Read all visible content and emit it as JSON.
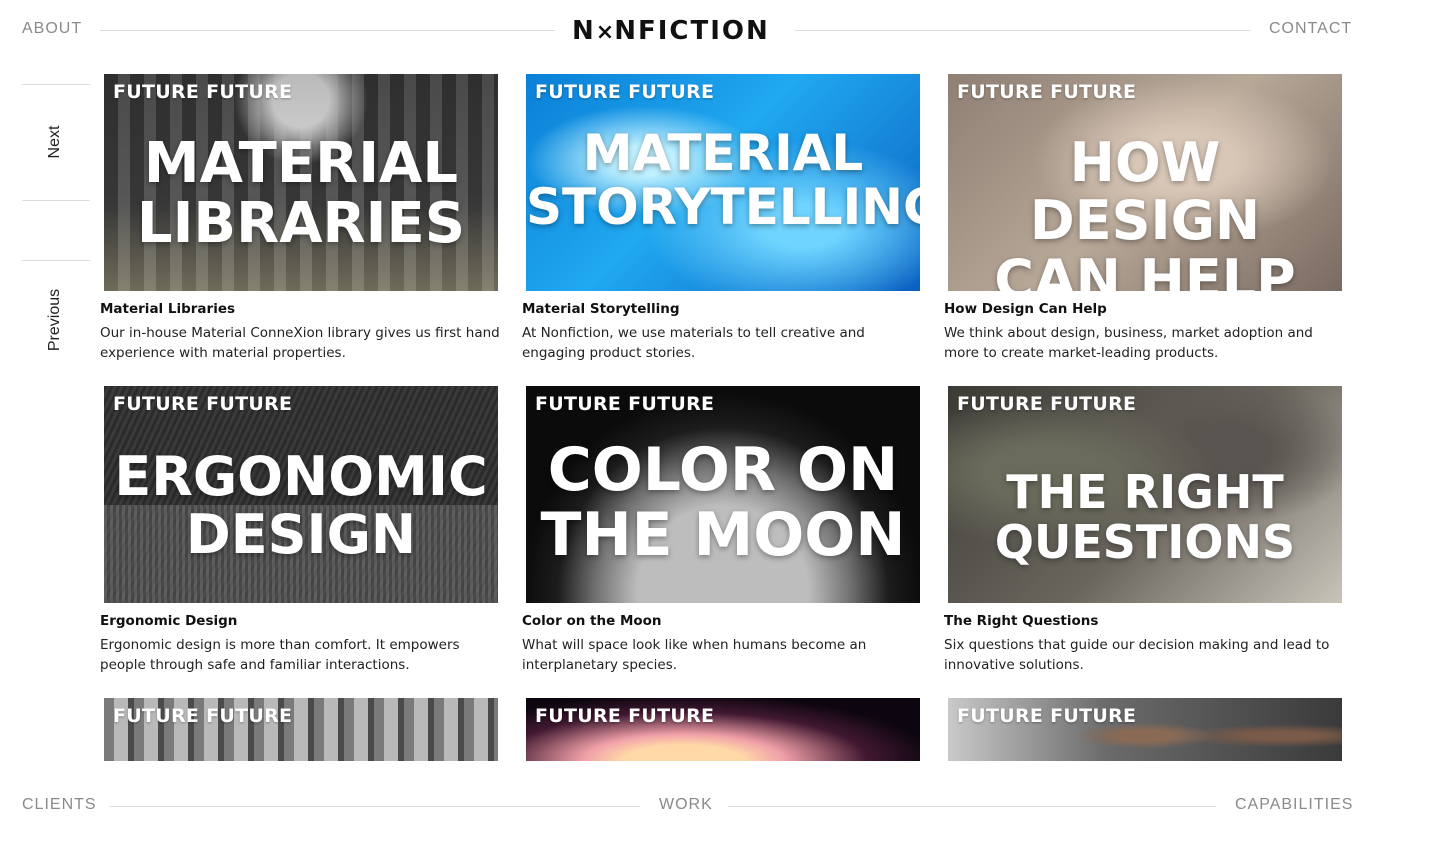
{
  "nav": {
    "about": "ABOUT",
    "contact": "CONTACT",
    "logo_left": "N",
    "logo_x": "×",
    "logo_right": "NFICTION"
  },
  "side": {
    "next": "Next",
    "previous": "Previous"
  },
  "cards": [
    {
      "tag": "FUTURE FUTURE",
      "headline": [
        "MATERIAL",
        "LIBRARIES"
      ],
      "title": "Material Libraries",
      "desc": "Our in-house Material ConneXion library gives us first hand experience with material properties."
    },
    {
      "tag": "FUTURE FUTURE",
      "headline": [
        "MATERIAL",
        "STORYTELLING"
      ],
      "title": "Material Storytelling",
      "desc": "At Nonfiction, we use materials to tell creative and engaging product stories."
    },
    {
      "tag": "FUTURE FUTURE",
      "headline": [
        "HOW DESIGN",
        "CAN HELP"
      ],
      "title": "How Design Can Help",
      "desc": "We think about design, business, market adoption and more to create market-leading products."
    },
    {
      "tag": "FUTURE FUTURE",
      "headline": [
        "ERGONOMIC",
        "DESIGN"
      ],
      "title": "Ergonomic Design",
      "desc": "Ergonomic design is more than comfort. It empowers people through safe and familiar interactions."
    },
    {
      "tag": "FUTURE FUTURE",
      "headline": [
        "COLOR ON",
        "THE MOON"
      ],
      "title": "Color on the Moon",
      "desc": "What will space look like when humans become an interplanetary species."
    },
    {
      "tag": "FUTURE FUTURE",
      "headline": [
        "THE RIGHT",
        "QUESTIONS"
      ],
      "title": "The Right Questions",
      "desc": "Six questions that guide our decision making and lead to innovative solutions."
    },
    {
      "tag": "FUTURE FUTURE"
    },
    {
      "tag": "FUTURE FUTURE"
    },
    {
      "tag": "FUTURE FUTURE"
    }
  ],
  "footer": {
    "clients": "CLIENTS",
    "work": "WORK",
    "capabilities": "CAPABILITIES"
  }
}
